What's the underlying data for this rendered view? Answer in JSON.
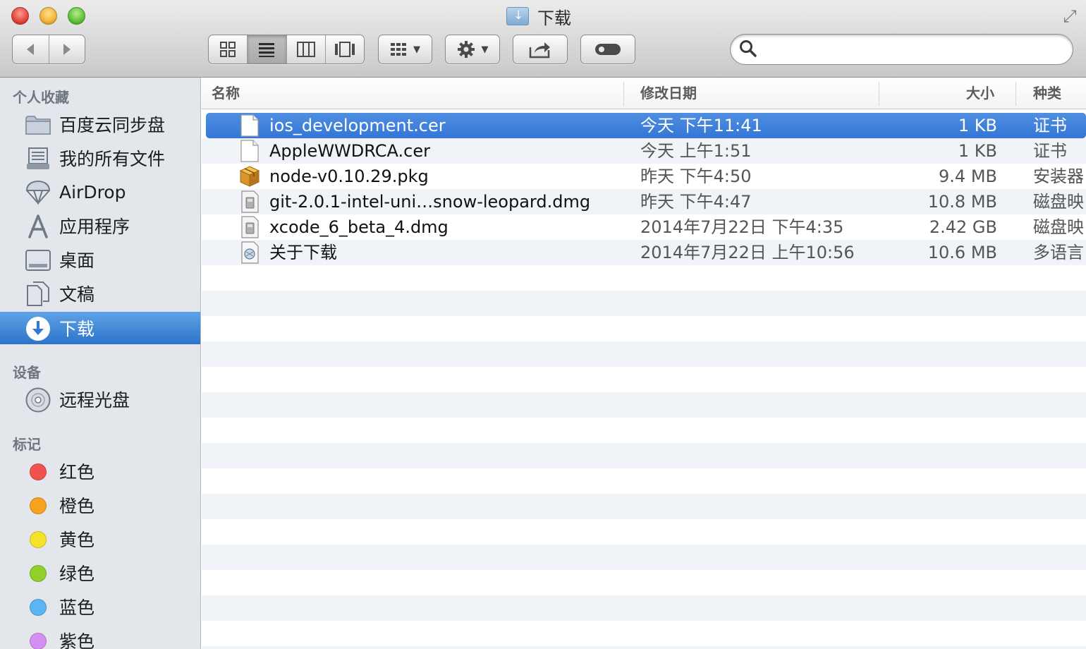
{
  "window": {
    "title": "下载"
  },
  "toolbar": {
    "back_icon": "back-arrow-icon",
    "forward_icon": "forward-arrow-icon",
    "view_modes": [
      "icon-view",
      "list-view",
      "column-view",
      "cover-flow-view"
    ],
    "active_view": "list-view",
    "search": {
      "value": "",
      "placeholder": ""
    }
  },
  "sidebar": {
    "favorites_title": "个人收藏",
    "favorites": [
      {
        "label": "百度云同步盘",
        "icon": "folder-icon"
      },
      {
        "label": "我的所有文件",
        "icon": "all-files-icon"
      },
      {
        "label": "AirDrop",
        "icon": "airdrop-icon"
      },
      {
        "label": "应用程序",
        "icon": "applications-icon"
      },
      {
        "label": "桌面",
        "icon": "desktop-icon"
      },
      {
        "label": "文稿",
        "icon": "documents-icon"
      },
      {
        "label": "下载",
        "icon": "downloads-icon",
        "selected": true
      }
    ],
    "devices_title": "设备",
    "devices": [
      {
        "label": "远程光盘",
        "icon": "optical-disc-icon"
      }
    ],
    "tags_title": "标记",
    "tags": [
      {
        "label": "红色",
        "color": "#f2524f"
      },
      {
        "label": "橙色",
        "color": "#f7a21c"
      },
      {
        "label": "黄色",
        "color": "#f5e22a"
      },
      {
        "label": "绿色",
        "color": "#8fd12a"
      },
      {
        "label": "蓝色",
        "color": "#5ab6f2"
      },
      {
        "label": "紫色",
        "color": "#d58ff0"
      }
    ]
  },
  "columns": {
    "name": "名称",
    "date": "修改日期",
    "size": "大小",
    "kind": "种类"
  },
  "files": [
    {
      "name": "ios_development.cer",
      "date": "今天 下午11:41",
      "size": "1 KB",
      "kind": "证书",
      "icon": "document-icon",
      "selected": true
    },
    {
      "name": "AppleWWDRCA.cer",
      "date": "今天 上午1:51",
      "size": "1 KB",
      "kind": "证书",
      "icon": "document-icon"
    },
    {
      "name": "node-v0.10.29.pkg",
      "date": "昨天 下午4:50",
      "size": "9.4 MB",
      "kind": "安装器",
      "icon": "package-icon"
    },
    {
      "name": "git-2.0.1-intel-uni…snow-leopard.dmg",
      "date": "昨天 下午4:47",
      "size": "10.8 MB",
      "kind": "磁盘映",
      "icon": "disk-image-icon"
    },
    {
      "name": "xcode_6_beta_4.dmg",
      "date": "2014年7月22日 下午4:35",
      "size": "2.42 GB",
      "kind": "磁盘映",
      "icon": "disk-image-icon"
    },
    {
      "name": "关于下载",
      "date": "2014年7月22日 上午10:56",
      "size": "10.6 MB",
      "kind": "多语言",
      "icon": "localized-doc-icon"
    }
  ]
}
